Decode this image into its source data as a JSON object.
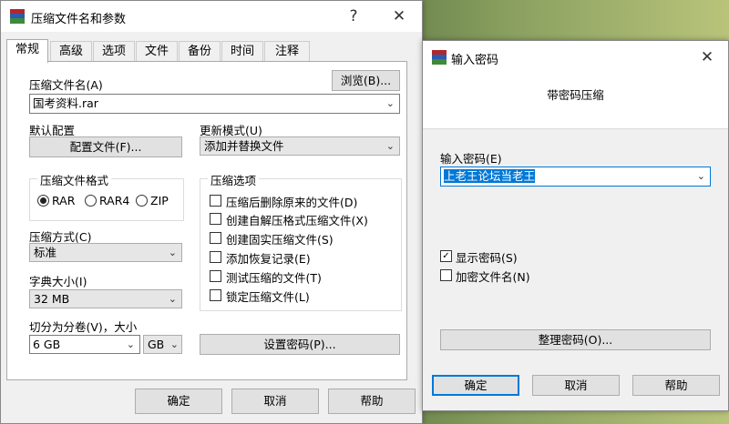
{
  "main_window": {
    "title": "压缩文件名和参数",
    "help_glyph": "?",
    "close_glyph": "✕",
    "tabs": [
      "常规",
      "高级",
      "选项",
      "文件",
      "备份",
      "时间",
      "注释"
    ],
    "archive_name_label": "压缩文件名(A)",
    "browse_button": "浏览(B)...",
    "archive_name_value": "国考资料.rar",
    "default_profile_label": "默认配置",
    "profile_button": "配置文件(F)...",
    "update_mode_label": "更新模式(U)",
    "update_mode_value": "添加并替换文件",
    "format_group": "压缩文件格式",
    "formats": [
      {
        "label": "RAR",
        "selected": true
      },
      {
        "label": "RAR4",
        "selected": false
      },
      {
        "label": "ZIP",
        "selected": false
      }
    ],
    "options_group": "压缩选项",
    "options": [
      {
        "label": "压缩后删除原来的文件(D)",
        "checked": false
      },
      {
        "label": "创建自解压格式压缩文件(X)",
        "checked": false
      },
      {
        "label": "创建固实压缩文件(S)",
        "checked": false
      },
      {
        "label": "添加恢复记录(E)",
        "checked": false
      },
      {
        "label": "测试压缩的文件(T)",
        "checked": false
      },
      {
        "label": "锁定压缩文件(L)",
        "checked": false
      }
    ],
    "method_label": "压缩方式(C)",
    "method_value": "标准",
    "dict_label": "字典大小(I)",
    "dict_value": "32 MB",
    "split_label": "切分为分卷(V)，大小",
    "split_value": "6 GB",
    "split_unit": "GB",
    "set_password_button": "设置密码(P)...",
    "ok_button": "确定",
    "cancel_button": "取消",
    "help_button": "帮助"
  },
  "password_dialog": {
    "title": "输入密码",
    "close_glyph": "✕",
    "header": "带密码压缩",
    "password_label": "输入密码(E)",
    "password_value": "上老王论坛当老王",
    "show_password": {
      "label": "显示密码(S)",
      "checked": true
    },
    "encrypt_names": {
      "label": "加密文件名(N)",
      "checked": false
    },
    "organize_button": "整理密码(O)...",
    "ok_button": "确定",
    "cancel_button": "取消",
    "help_button": "帮助"
  },
  "colors": {
    "selection": "#0078d7",
    "icon_red": "#b3262b",
    "icon_blue": "#2a5bb0",
    "icon_green": "#3d8a3a"
  }
}
